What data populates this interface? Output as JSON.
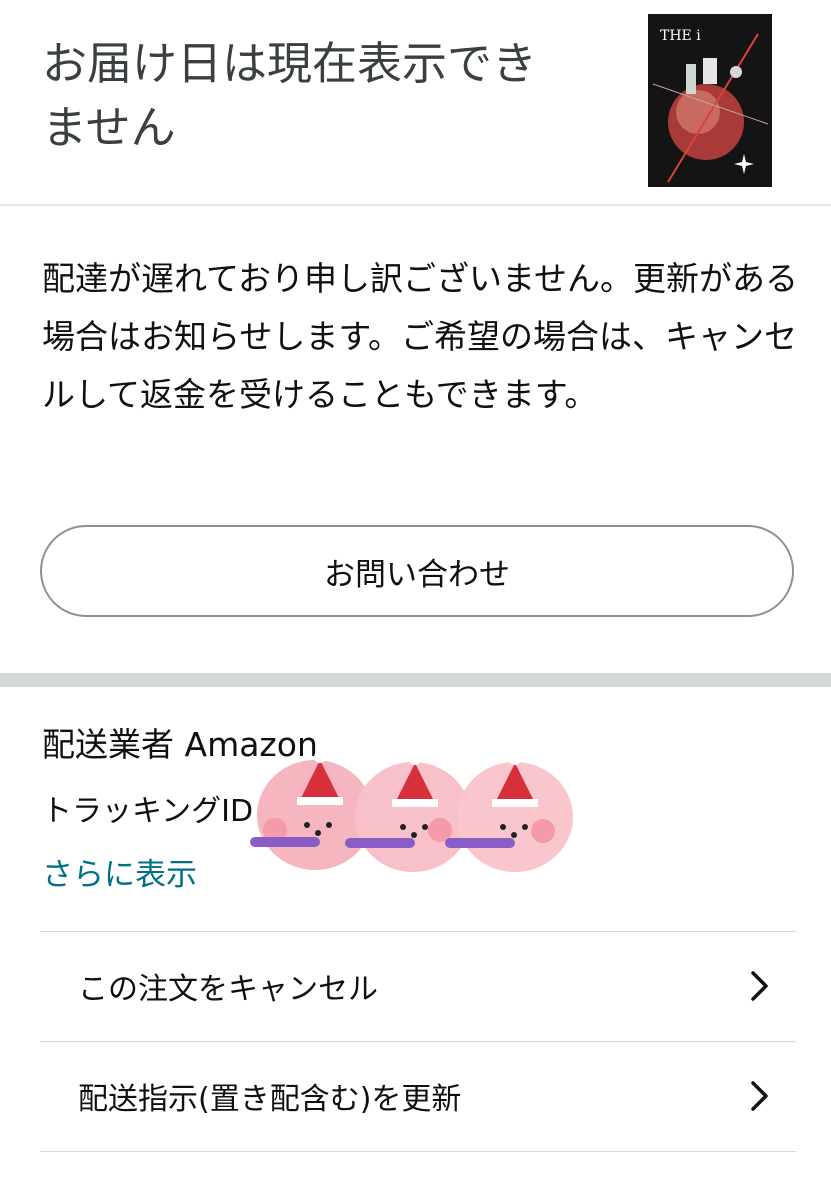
{
  "header": {
    "status_title": "お届け日は現在表示できません"
  },
  "product_thumbnail": {
    "cover_text": "THE i"
  },
  "delay_message": "配達が遅れており申し訳ございません。更新がある場合はお知らせします。ご希望の場合は、キャンセルして返金を受けることもできます。",
  "contact_button_label": "お問い合わせ",
  "shipment": {
    "carrier_text": "配送業者 Amazon",
    "tracking_label": "トラッキングID",
    "show_more_label": "さらに表示"
  },
  "actions": [
    {
      "label": "この注文をキャンセル",
      "icon": "chevron-right-icon"
    },
    {
      "label": "配送指示(置き配含む)を更新",
      "icon": "chevron-right-icon"
    }
  ],
  "colors": {
    "link": "#007185",
    "text": "#0f1111",
    "divider": "#d5d9d9",
    "sticker_pink": "#f6b6c0",
    "sticker_hat": "#d6303d",
    "sticker_scarf": "#8a5cc7"
  }
}
